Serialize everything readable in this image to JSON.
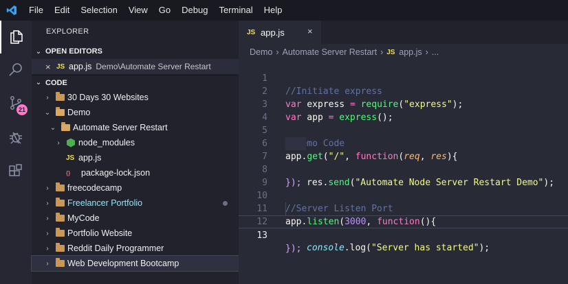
{
  "menu": [
    "File",
    "Edit",
    "Selection",
    "View",
    "Go",
    "Debug",
    "Terminal",
    "Help"
  ],
  "activity_bar": {
    "icons": [
      "explorer-icon",
      "search-icon",
      "source-control-icon",
      "debug-icon",
      "extensions-icon"
    ],
    "scm_badge": "21"
  },
  "sidebar": {
    "title": "EXPLORER",
    "open_editors": {
      "header": "OPEN EDITORS",
      "items": [
        {
          "close": "×",
          "icon": "JS",
          "file": "app.js",
          "path": "Demo\\Automate Server Restart"
        }
      ]
    },
    "workspace": {
      "header": "CODE",
      "items": [
        {
          "label": "30 Days 30 Websites",
          "chevron": "›"
        },
        {
          "label": "Demo",
          "chevron": "⌄"
        },
        {
          "label": "Automate Server Restart",
          "chevron": "⌄"
        },
        {
          "label": "node_modules",
          "chevron": "›"
        },
        {
          "label": "app.js",
          "icon": "JS"
        },
        {
          "label": "package-lock.json",
          "icon": "{}"
        },
        {
          "label": "freecodecamp",
          "chevron": "›"
        },
        {
          "label": "Freelancer Portfolio",
          "chevron": "›"
        },
        {
          "label": "MyCode",
          "chevron": "›"
        },
        {
          "label": "Portfolio Website",
          "chevron": "›"
        },
        {
          "label": "Reddit Daily Programmer",
          "chevron": "›"
        },
        {
          "label": "Web Development Bootcamp",
          "chevron": "›"
        }
      ]
    }
  },
  "editor": {
    "tab": {
      "icon": "JS",
      "label": "app.js",
      "close": "×"
    },
    "breadcrumb": {
      "part1": "Demo",
      "part2": "Automate Server Restart",
      "icon": "JS",
      "part3": "app.js",
      "part4": "..."
    },
    "line_numbers": [
      "1",
      "2",
      "3",
      "4",
      "5",
      "6",
      "7",
      "8",
      "9",
      "10",
      "11",
      "12",
      "13"
    ],
    "code": {
      "l1": "//Initiate express",
      "l2_var": "var",
      "l2_name": " express ",
      "l2_eq": "=",
      "l2_fn": " require",
      "l2_open": "(",
      "l2_str": "\"express\"",
      "l2_close": ");",
      "l3_var": "var",
      "l3_name": " app ",
      "l3_eq": "=",
      "l3_fn": " express",
      "l3_rest": "();",
      "l5": "//Demo Code",
      "l6_obj": "app.",
      "l6_fn": "get",
      "l6_open": "(",
      "l6_str": "\"/\"",
      "l6_comma": ", ",
      "l6_kw": "function",
      "l6_po": "(",
      "l6_p1": "req",
      "l6_c": ", ",
      "l6_p2": "res",
      "l6_pc": "){",
      "l7_obj": "res.",
      "l7_fn": "send",
      "l7_open": "(",
      "l7_str": "\"Automate Node Server Restart Demo\"",
      "l7_close": ");",
      "l8": "});",
      "l10": "//Server Listen Port",
      "l11_obj": "app.",
      "l11_fn": "listen",
      "l11_open": "(",
      "l11_num": "3000",
      "l11_comma": ", ",
      "l11_kw": "function",
      "l11_rest": "(){",
      "l12_obj": "console",
      "l12_dot": ".log",
      "l12_open": "(",
      "l12_str": "\"Server has started\"",
      "l12_close": ");",
      "l13": "});"
    }
  }
}
